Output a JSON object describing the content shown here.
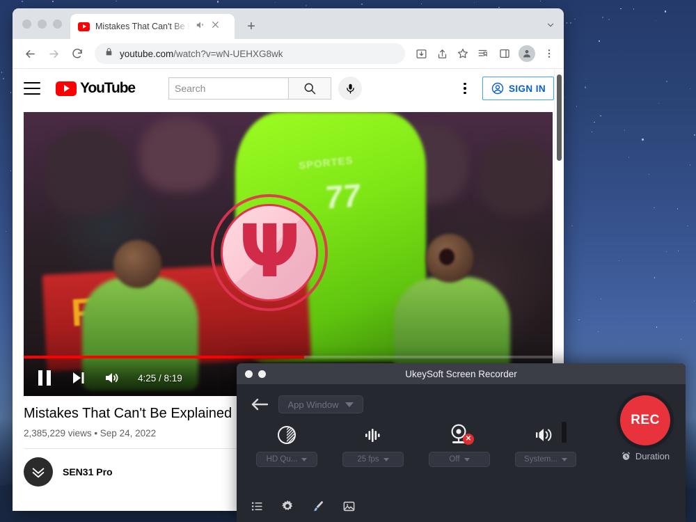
{
  "browser": {
    "tab": {
      "title": "Mistakes That Can't Be Exp",
      "favicon_name": "youtube-favicon",
      "audio_icon": "speaker-muted-icon",
      "close_icon": "close-icon"
    },
    "new_tab_label": "+",
    "toolbar": {
      "back_icon": "back-arrow-icon",
      "forward_icon": "forward-arrow-icon",
      "reload_icon": "reload-icon",
      "lock_icon": "lock-icon",
      "url_domain": "youtube.com",
      "url_path": "/watch?v=wN-UEHXG8wk",
      "install_icon": "install-app-icon",
      "share_icon": "share-icon",
      "bookmark_icon": "star-icon",
      "reading_list_icon": "reading-list-icon",
      "side_panel_icon": "side-panel-icon",
      "profile_icon": "profile-avatar-icon",
      "menu_icon": "three-dot-menu-icon"
    }
  },
  "youtube": {
    "header": {
      "menu_icon": "hamburger-menu-icon",
      "logo_text": "YouTube",
      "search_placeholder": "Search",
      "search_value": "",
      "search_icon": "search-icon",
      "mic_icon": "microphone-icon",
      "kebab_icon": "three-dot-menu-icon",
      "signin_label": "SIGN IN",
      "signin_icon": "account-circle-icon",
      "accent_color": "#065fd4",
      "brand_color": "#ff0000"
    },
    "player": {
      "pause_icon": "pause-icon",
      "next_icon": "next-video-icon",
      "volume_icon": "volume-icon",
      "current_time": "4:25",
      "duration": "8:19",
      "time_display": "4:25 / 8:19",
      "progress_percent": 53,
      "progress_color": "#ff0000",
      "watermark_glyph": "Ψ",
      "watermark_ring_color": "#e0344f",
      "jersey_text": "SPORTES",
      "jersey_number": "77",
      "banner_text": "FIN"
    },
    "video": {
      "title": "Mistakes That Can't Be Explained",
      "views": "2,385,229 views",
      "separator": "•",
      "published": "Sep 24, 2022",
      "meta_line": "2,385,229 views • Sep 24, 2022",
      "channel_name": "SEN31 Pro",
      "channel_avatar_icon": "channel-avatar-icon"
    }
  },
  "recorder": {
    "window_title": "UkeySoft Screen Recorder",
    "traffic_lights": [
      "close-button",
      "minimize-button"
    ],
    "back_icon": "back-arrow-icon",
    "source": {
      "label": "App Window",
      "caret_icon": "chevron-down-icon"
    },
    "options": [
      {
        "id": "quality",
        "icon_name": "contrast-quality-icon",
        "value": "HD Qu...",
        "caret_icon": "chevron-down-icon"
      },
      {
        "id": "framerate",
        "icon_name": "waveform-fps-icon",
        "value": "25 fps",
        "caret_icon": "chevron-down-icon"
      },
      {
        "id": "webcam",
        "icon_name": "webcam-disabled-icon",
        "value": "Off",
        "caret_icon": "chevron-down-icon"
      },
      {
        "id": "audio",
        "icon_name": "speaker-volume-icon",
        "value": "System...",
        "caret_icon": "chevron-down-icon"
      }
    ],
    "record_button_label": "REC",
    "record_button_color": "#e8333c",
    "duration_label": "Duration",
    "duration_icon": "alarm-clock-icon",
    "tools": [
      {
        "id": "recordings-list",
        "icon_name": "list-icon"
      },
      {
        "id": "settings",
        "icon_name": "gear-icon"
      },
      {
        "id": "annotate",
        "icon_name": "brush-icon"
      },
      {
        "id": "screenshot",
        "icon_name": "image-icon"
      }
    ]
  }
}
